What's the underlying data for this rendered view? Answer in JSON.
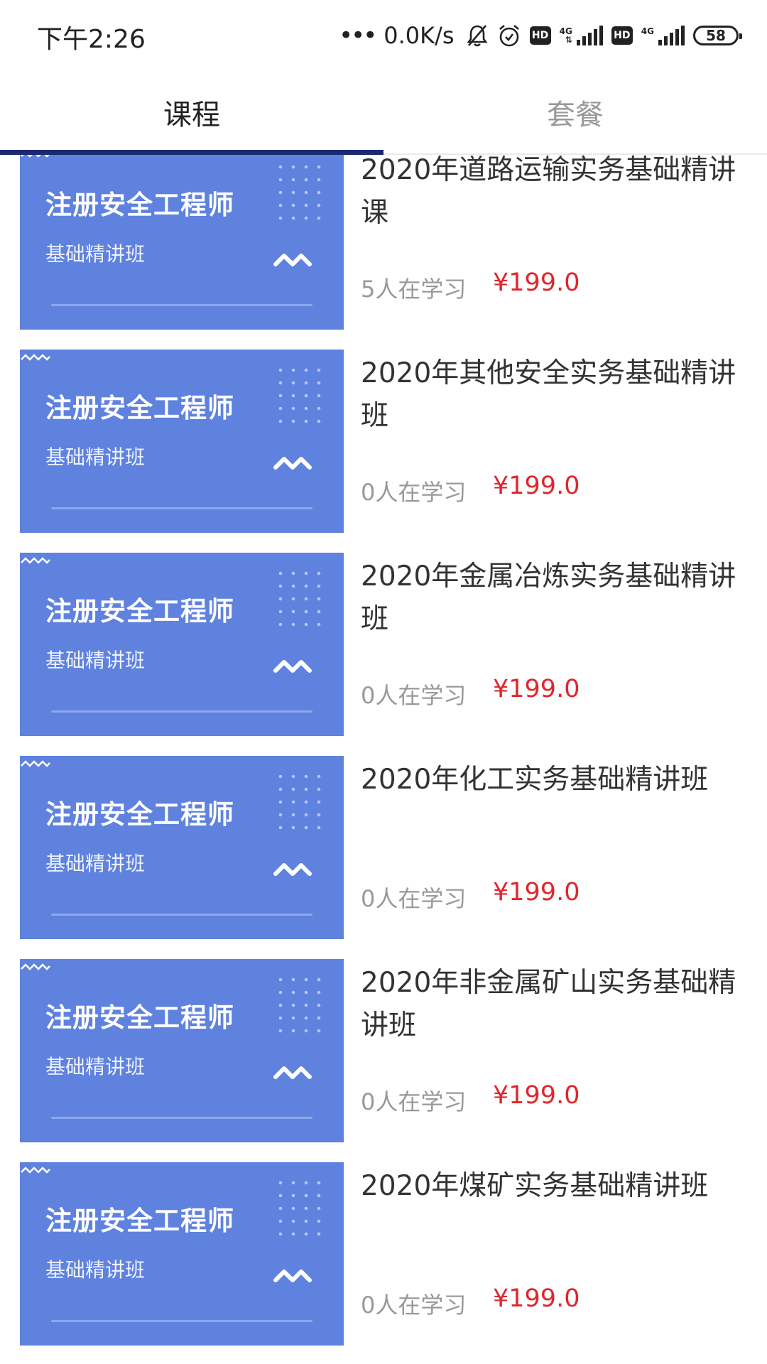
{
  "status_bar": {
    "time": "下午2:26",
    "dots": "•••",
    "net_speed": "0.0K/s",
    "hd_label": "HD",
    "network_type": "4G",
    "battery": "58"
  },
  "tabs": [
    {
      "label": "课程",
      "active": true
    },
    {
      "label": "套餐",
      "active": false
    }
  ],
  "accent_colors": {
    "tab_indicator": "#1d2a6e",
    "price": "#e0262c",
    "thumbnail": "#5f82df"
  },
  "courses": [
    {
      "thumb_title": "注册安全工程师",
      "thumb_subtitle": "基础精讲班",
      "title": "2020年道路运输实务基础精讲课",
      "learners": "5人在学习",
      "price": "¥199.0"
    },
    {
      "thumb_title": "注册安全工程师",
      "thumb_subtitle": "基础精讲班",
      "title": "2020年其他安全实务基础精讲班",
      "learners": "0人在学习",
      "price": "¥199.0"
    },
    {
      "thumb_title": "注册安全工程师",
      "thumb_subtitle": "基础精讲班",
      "title": "2020年金属冶炼实务基础精讲班",
      "learners": "0人在学习",
      "price": "¥199.0"
    },
    {
      "thumb_title": "注册安全工程师",
      "thumb_subtitle": "基础精讲班",
      "title": "2020年化工实务基础精讲班",
      "learners": "0人在学习",
      "price": "¥199.0"
    },
    {
      "thumb_title": "注册安全工程师",
      "thumb_subtitle": "基础精讲班",
      "title": "2020年非金属矿山实务基础精讲班",
      "learners": "0人在学习",
      "price": "¥199.0"
    },
    {
      "thumb_title": "注册安全工程师",
      "thumb_subtitle": "基础精讲班",
      "title": "2020年煤矿实务基础精讲班",
      "learners": "0人在学习",
      "price": "¥199.0"
    }
  ]
}
